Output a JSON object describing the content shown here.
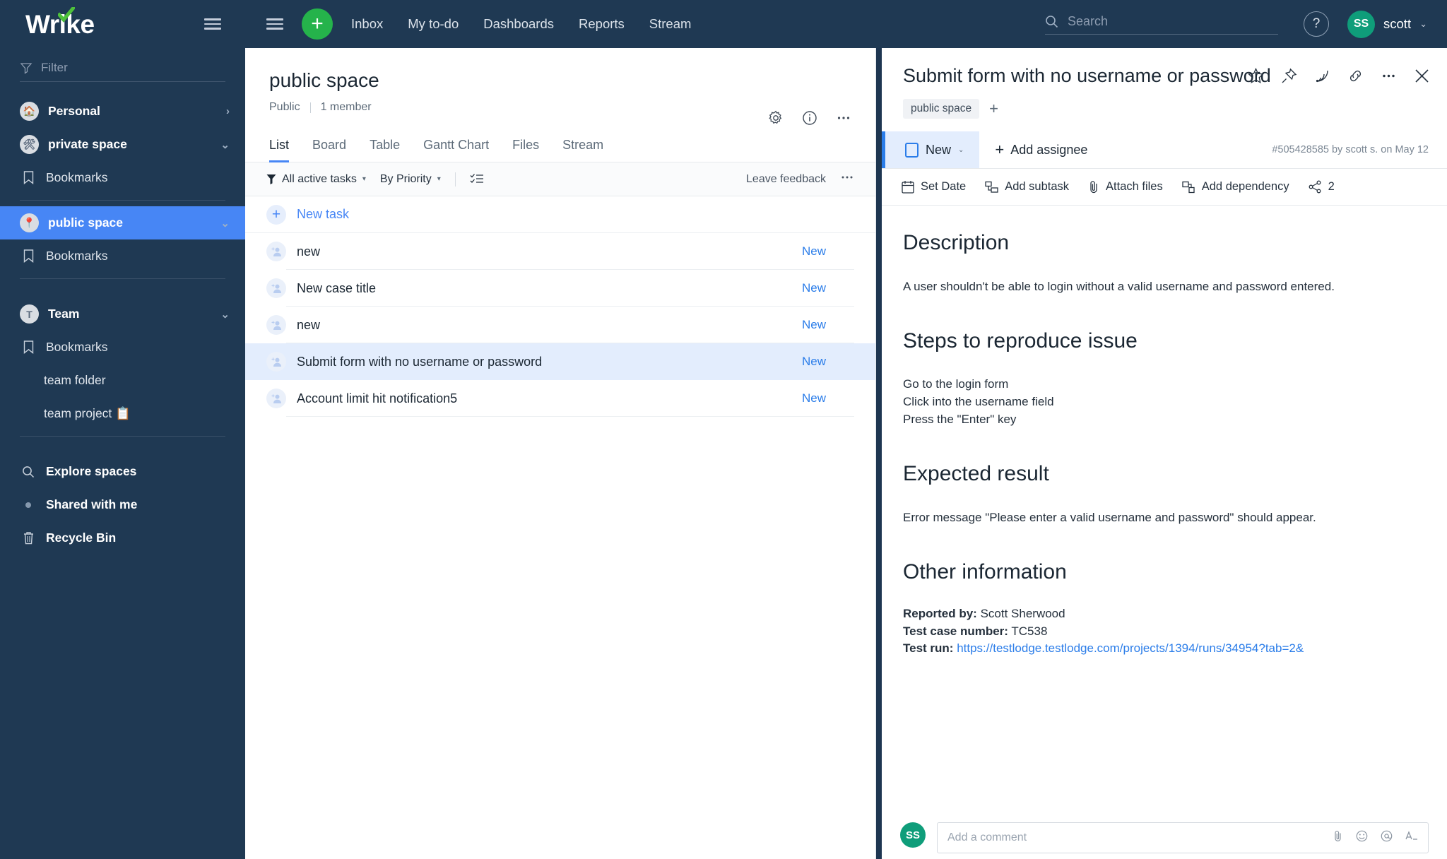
{
  "brand": {
    "logo_text": "Wrike",
    "accent_green": "#25b34b",
    "accent_blue": "#4786f5",
    "sidebar_bg": "#1f3953"
  },
  "topbar": {
    "plus_label": "+",
    "nav": [
      {
        "label": "Inbox"
      },
      {
        "label": "My to-do"
      },
      {
        "label": "Dashboards"
      },
      {
        "label": "Reports"
      },
      {
        "label": "Stream"
      }
    ],
    "search_placeholder": "Search",
    "help_label": "?",
    "user_initials": "SS",
    "user_name": "scott"
  },
  "sidebar": {
    "filter_placeholder": "Filter",
    "items": [
      {
        "label": "Personal",
        "type": "space",
        "icon": "house-icon",
        "chevron": "right",
        "active": false
      },
      {
        "label": "private space",
        "type": "space",
        "icon": "tools-icon",
        "chevron": "down",
        "active": false
      },
      {
        "label": "Bookmarks",
        "type": "bookmark",
        "icon": "bookmark-icon",
        "active": false
      },
      {
        "label": "public space",
        "type": "space",
        "icon": "pin-icon",
        "chevron": "down",
        "active": true
      },
      {
        "label": "Bookmarks",
        "type": "bookmark",
        "icon": "bookmark-icon",
        "active": false
      },
      {
        "label": "Team",
        "type": "space",
        "icon": "letter-t-icon",
        "chevron": "down",
        "active": false
      },
      {
        "label": "Bookmarks",
        "type": "bookmark",
        "icon": "bookmark-icon",
        "active": false
      },
      {
        "label": "team folder",
        "type": "sub",
        "active": false
      },
      {
        "label": "team project 📋",
        "type": "sub",
        "active": false
      }
    ],
    "footer": [
      {
        "label": "Explore spaces",
        "icon": "search-icon"
      },
      {
        "label": "Shared with me",
        "icon": "dot-icon"
      },
      {
        "label": "Recycle Bin",
        "icon": "trash-icon"
      }
    ]
  },
  "center": {
    "title": "public space",
    "visibility": "Public",
    "members": "1 member",
    "header_icons": [
      "gear-icon",
      "info-icon",
      "more-icon"
    ],
    "tabs": [
      {
        "label": "List",
        "active": true
      },
      {
        "label": "Board",
        "active": false
      },
      {
        "label": "Table",
        "active": false
      },
      {
        "label": "Gantt Chart",
        "active": false
      },
      {
        "label": "Files",
        "active": false
      },
      {
        "label": "Stream",
        "active": false
      }
    ],
    "toolbar": {
      "filter_label": "All active tasks",
      "sort_label": "By Priority",
      "feedback_label": "Leave feedback"
    },
    "new_task_label": "New task",
    "tasks": [
      {
        "title": "new",
        "status": "New",
        "selected": false
      },
      {
        "title": "New case title",
        "status": "New",
        "selected": false
      },
      {
        "title": "new",
        "status": "New",
        "selected": false
      },
      {
        "title": "Submit form with no username or password",
        "status": "New",
        "selected": true
      },
      {
        "title": "Account limit hit notification5",
        "status": "New",
        "selected": false
      }
    ]
  },
  "detail": {
    "title": "Submit form with no username or password",
    "icons": [
      "star-icon",
      "pin-icon",
      "stream-icon",
      "link-icon",
      "more-icon",
      "close-icon"
    ],
    "tag": "public space",
    "tag_add": "+",
    "status": "New",
    "add_assignee": "Add assignee",
    "meta": "#505428585 by scott s. on May 12",
    "actions": [
      {
        "label": "Set Date",
        "icon": "calendar-icon"
      },
      {
        "label": "Add subtask",
        "icon": "subtask-icon"
      },
      {
        "label": "Attach files",
        "icon": "paperclip-icon"
      },
      {
        "label": "Add dependency",
        "icon": "dependency-icon"
      },
      {
        "label": "2",
        "icon": "share-icon"
      }
    ],
    "sections": {
      "description_heading": "Description",
      "description_text": "A user shouldn't be able to login without a valid username and password entered.",
      "steps_heading": "Steps to reproduce issue",
      "steps": [
        "Go to the login form",
        "Click into the username field",
        "Press the \"Enter\" key"
      ],
      "expected_heading": "Expected result",
      "expected_text": "Error message \"Please enter a valid username and password\" should appear.",
      "other_heading": "Other information",
      "other": [
        {
          "key": "Reported by:",
          "value": " Scott Sherwood",
          "link": ""
        },
        {
          "key": "Test case number:",
          "value": " TC538",
          "link": ""
        },
        {
          "key": "Test run:",
          "value": " ",
          "link": "https://testlodge.testlodge.com/projects/1394/runs/34954?tab=2&"
        }
      ]
    },
    "comment": {
      "avatar_initials": "SS",
      "placeholder": "Add a comment"
    }
  }
}
